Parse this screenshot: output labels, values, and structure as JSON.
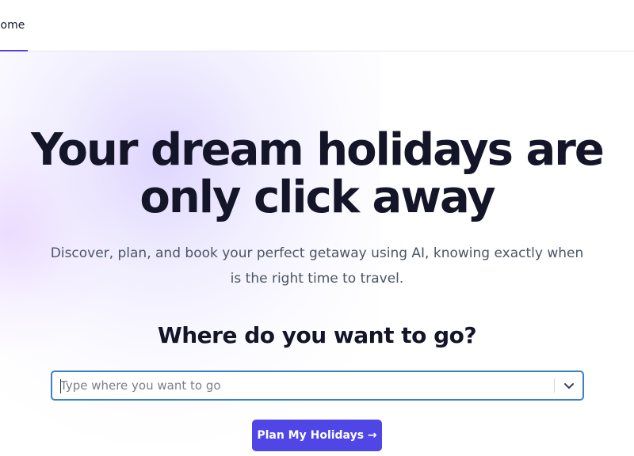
{
  "nav": {
    "home_label": "Home",
    "accent_color": "#5b3fd6"
  },
  "hero": {
    "headline": "Your dream holidays are only click away",
    "subtitle": "Discover, plan, and book your perfect getaway using AI, knowing exactly when is the right time to travel.",
    "question": "Where do you want to go?"
  },
  "search": {
    "placeholder": "Type where you want to go",
    "value": "",
    "icon": "chevron-down-icon",
    "border_color": "#3b82c4"
  },
  "cta": {
    "label": "Plan My Holidays →",
    "color": "#4f46e5"
  }
}
